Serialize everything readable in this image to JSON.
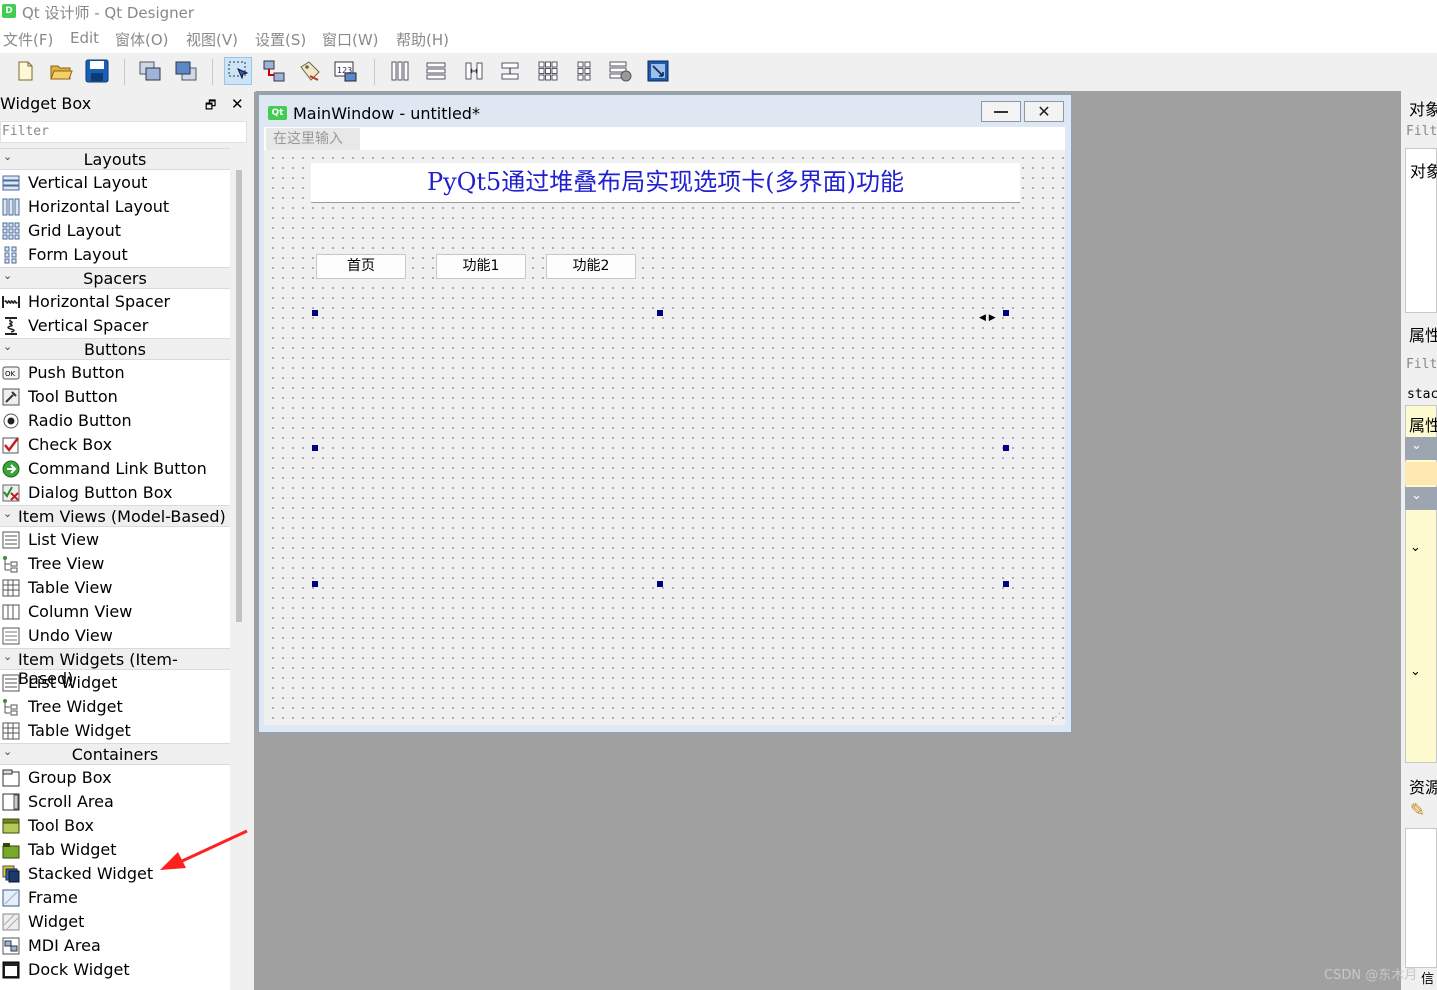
{
  "window": {
    "title": "Qt 设计师 - Qt Designer",
    "logo": "D"
  },
  "menubar": [
    "文件(F)",
    "Edit",
    "窗体(O)",
    "视图(V)",
    "设置(S)",
    "窗口(W)",
    "帮助(H)"
  ],
  "toolbar": {
    "icons": [
      "new-file-icon",
      "open-folder-icon",
      "save-icon",
      "send-to-back-icon",
      "bring-to-front-icon",
      "edit-widgets-icon",
      "edit-signals-slots-icon",
      "edit-buddies-icon",
      "edit-tab-order-icon",
      "layout-horizontal-icon",
      "layout-vertical-icon",
      "layout-horizontal-splitter-icon",
      "layout-vertical-splitter-icon",
      "layout-grid-icon",
      "layout-form-icon",
      "break-layout-icon",
      "adjust-size-icon"
    ]
  },
  "widget_box": {
    "title": "Widget Box",
    "filter_placeholder": "Filter",
    "categories": [
      {
        "label": "Layouts",
        "items": [
          "Vertical Layout",
          "Horizontal Layout",
          "Grid Layout",
          "Form Layout"
        ]
      },
      {
        "label": "Spacers",
        "items": [
          "Horizontal Spacer",
          "Vertical Spacer"
        ]
      },
      {
        "label": "Buttons",
        "items": [
          "Push Button",
          "Tool Button",
          "Radio Button",
          "Check Box",
          "Command Link Button",
          "Dialog Button Box"
        ]
      },
      {
        "label": "Item Views (Model-Based)",
        "items": [
          "List View",
          "Tree View",
          "Table View",
          "Column View",
          "Undo View"
        ]
      },
      {
        "label": "Item Widgets (Item-Based)",
        "items": [
          "List Widget",
          "Tree Widget",
          "Table Widget"
        ]
      },
      {
        "label": "Containers",
        "items": [
          "Group Box",
          "Scroll Area",
          "Tool Box",
          "Tab Widget",
          "Stacked Widget",
          "Frame",
          "Widget",
          "MDI Area",
          "Dock Widget"
        ]
      }
    ]
  },
  "form": {
    "qt_badge": "Qt",
    "title": "MainWindow - untitled*",
    "menu_placeholder": "在这里输入",
    "heading": "PyQt5通过堆叠布局实现选项卡(多界面)功能",
    "buttons": [
      "首页",
      "功能1",
      "功能2"
    ]
  },
  "right_panel": {
    "object_inspector_title": "对象",
    "object_filter": "Filt",
    "object_tree_header": "对象",
    "property_editor_title": "属性",
    "property_filter": "Filt",
    "property_object": "stac",
    "property_header": "属性",
    "resource_title": "资源",
    "bottom_label": "信"
  },
  "watermark": "CSDN @东木月"
}
